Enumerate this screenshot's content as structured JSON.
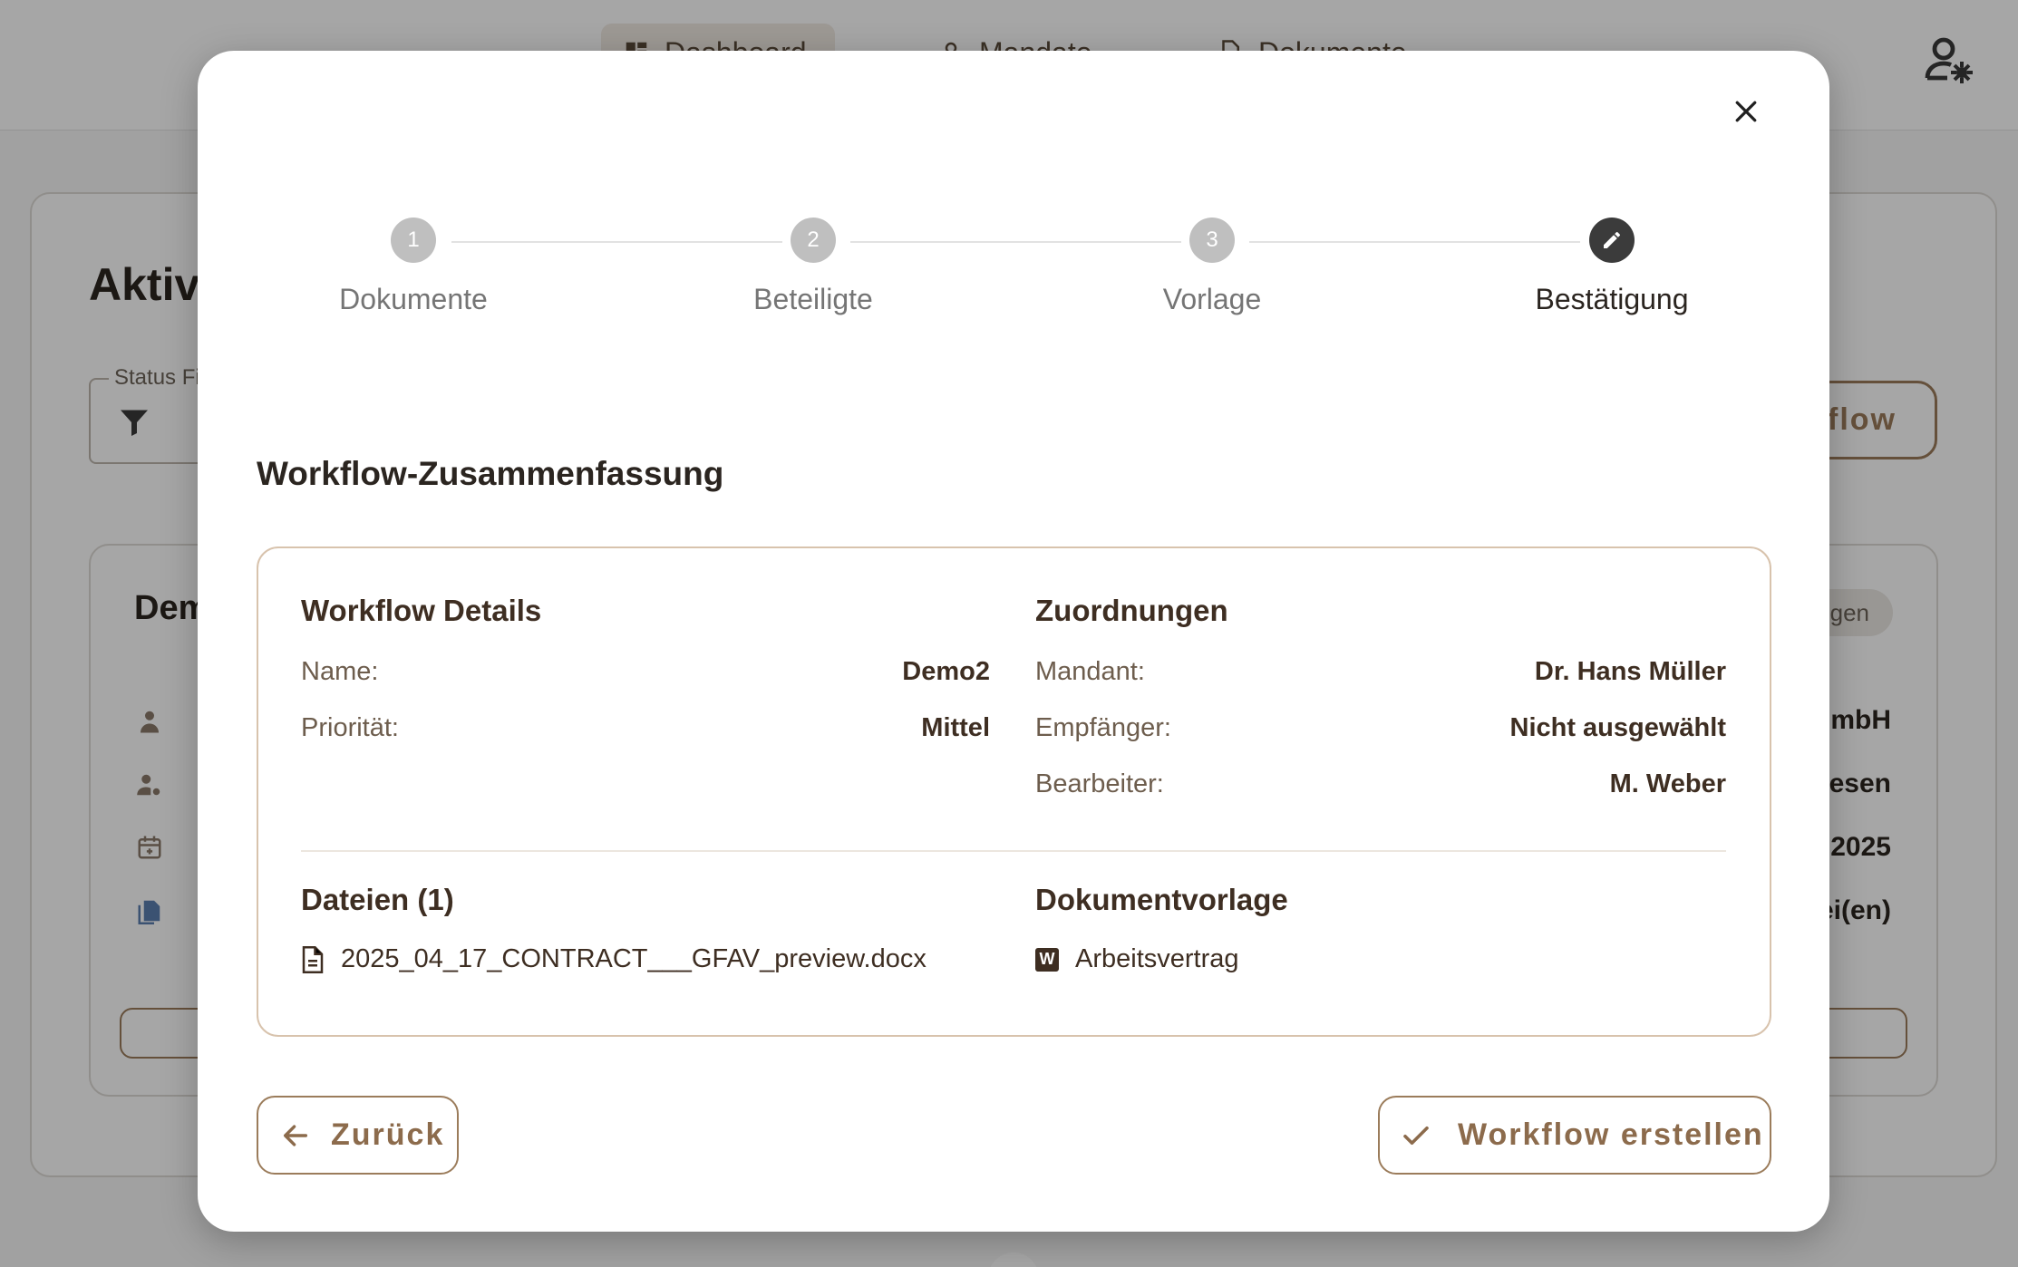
{
  "app": {
    "nav": {
      "dashboard": "Dashboard",
      "mandate": "Mandate",
      "documents": "Dokumente"
    },
    "page_heading": "Aktive Workflows",
    "status_filter_label": "Status Filter",
    "new_workflow_label": "Neuer Workflow",
    "workflow_card": {
      "title": "Demo",
      "badge": "Anzeigen",
      "rows": [
        "GmbH",
        "Wiesen",
        "2025",
        "Datei(en)"
      ]
    }
  },
  "modal": {
    "stepper": [
      {
        "number": "1",
        "label": "Dokumente"
      },
      {
        "number": "2",
        "label": "Beteiligte"
      },
      {
        "number": "3",
        "label": "Vorlage"
      },
      {
        "number": "",
        "label": "Bestätigung"
      }
    ],
    "summary_title": "Workflow-Zusammenfassung",
    "details": {
      "title": "Workflow Details",
      "name_key": "Name:",
      "name_val": "Demo2",
      "priority_key": "Priorität:",
      "priority_val": "Mittel"
    },
    "assignments": {
      "title": "Zuordnungen",
      "client_key": "Mandant:",
      "client_val": "Dr. Hans Müller",
      "recipient_key": "Empfänger:",
      "recipient_val": "Nicht ausgewählt",
      "editor_key": "Bearbeiter:",
      "editor_val": "M. Weber"
    },
    "files": {
      "title": "Dateien (1)",
      "items": [
        "2025_04_17_CONTRACT___GFAV_preview.docx"
      ]
    },
    "template": {
      "title": "Dokumentvorlage",
      "name": "Arbeitsvertrag",
      "icon_letter": "W"
    },
    "back_label": "Zurück",
    "create_label": "Workflow erstellen"
  },
  "colors": {
    "accent": "#9b7c5b",
    "border": "#d8c3ad",
    "step_active": "#3b3b3b",
    "step_inactive": "#bfbfbf"
  }
}
